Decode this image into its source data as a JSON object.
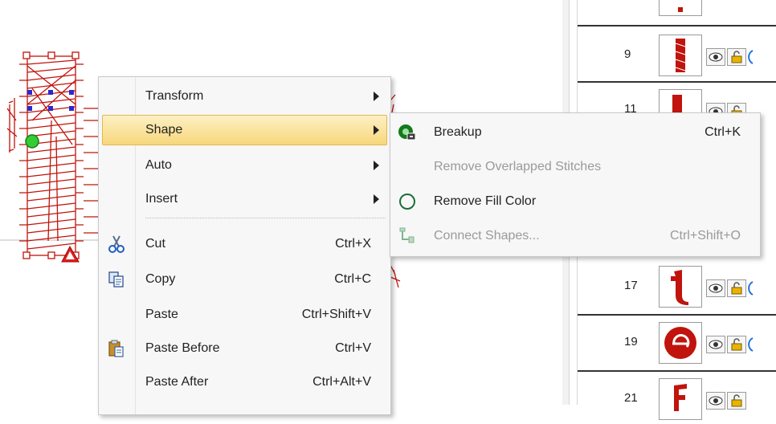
{
  "object_list": {
    "rows": [
      {
        "num": "",
        "thumb": "top-partial"
      },
      {
        "num": "9",
        "thumb": "tall-bar"
      },
      {
        "num": "11",
        "thumb": "tall-bar2"
      },
      {
        "num": "",
        "thumb": "hidden"
      },
      {
        "num": "",
        "thumb": "hidden"
      },
      {
        "num": "17",
        "thumb": "letter-t"
      },
      {
        "num": "19",
        "thumb": "letter-e"
      },
      {
        "num": "21",
        "thumb": "letter-f"
      }
    ]
  },
  "context_menu": {
    "items": [
      {
        "label": "Transform",
        "shortcut": "",
        "submenu": true,
        "icon": ""
      },
      {
        "label": "Shape",
        "shortcut": "",
        "submenu": true,
        "icon": "",
        "highlighted": true
      },
      {
        "label": "Auto",
        "shortcut": "",
        "submenu": true,
        "icon": ""
      },
      {
        "label": "Insert",
        "shortcut": "",
        "submenu": true,
        "icon": ""
      },
      {
        "label": "Cut",
        "shortcut": "Ctrl+X",
        "submenu": false,
        "icon": "scissors-icon"
      },
      {
        "label": "Copy",
        "shortcut": "Ctrl+C",
        "submenu": false,
        "icon": "copy-icon"
      },
      {
        "label": "Paste",
        "shortcut": "Ctrl+Shift+V",
        "submenu": false,
        "icon": ""
      },
      {
        "label": "Paste Before",
        "shortcut": "Ctrl+V",
        "submenu": false,
        "icon": "paste-icon"
      },
      {
        "label": "Paste After",
        "shortcut": "Ctrl+Alt+V",
        "submenu": false,
        "icon": ""
      }
    ]
  },
  "shape_submenu": {
    "items": [
      {
        "label": "Breakup",
        "shortcut": "Ctrl+K",
        "enabled": true,
        "icon": "breakup-icon"
      },
      {
        "label": "Remove Overlapped Stitches",
        "shortcut": "",
        "enabled": false,
        "icon": ""
      },
      {
        "label": "Remove Fill Color",
        "shortcut": "",
        "enabled": true,
        "icon": "circle-outline-icon"
      },
      {
        "label": "Connect Shapes...",
        "shortcut": "Ctrl+Shift+O",
        "enabled": false,
        "icon": "connect-shapes-icon"
      }
    ]
  },
  "colors": {
    "stitch": "#c0140c",
    "highlight_top": "#fdf0c4",
    "highlight_bottom": "#f7d77b",
    "node_green": "#33cc33",
    "node_blue": "#2a2acc"
  }
}
